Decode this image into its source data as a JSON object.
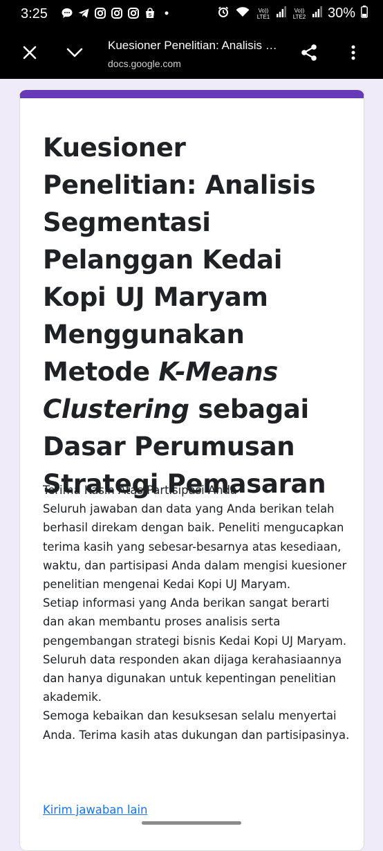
{
  "status_bar": {
    "time": "3:25",
    "battery": "30%",
    "lte1": "Vo)) LTE1",
    "lte2": "Vo)) LTE2",
    "icons": [
      "message-icon",
      "telegram-icon",
      "instagram-icon",
      "instagram-icon",
      "instagram-icon",
      "shopee-icon",
      "dot-icon",
      "alarm-icon",
      "wifi-icon",
      "signal-icon",
      "battery-icon"
    ]
  },
  "app_bar": {
    "title": "Kuesioner Penelitian: Analisis Segmentasi Pelanggan Kedai Kopi UJ Maryam Menggunakan Metode K-Means Clustering sebagai Dasar Perumusan Strategi Pemasaran",
    "url": "docs.google.com"
  },
  "form": {
    "title_part1": "Kuesioner Penelitian:  Analisis Segmentasi Pelanggan Kedai Kopi UJ Maryam Menggunakan Metode ",
    "title_italic": "K-Means Clustering",
    "title_part2": " sebagai Dasar Perumusan Strategi Pemasaran",
    "accent_color": "#673ab7",
    "confirmation": [
      "Terima Kasih Atas Partisipasi Anda",
      "Seluruh jawaban dan data yang Anda berikan telah berhasil direkam dengan baik. Peneliti mengucapkan terima kasih yang sebesar-besarnya atas kesediaan, waktu, dan partisipasi Anda dalam mengisi kuesioner penelitian mengenai Kedai Kopi UJ Maryam.",
      "Setiap informasi yang Anda berikan sangat berarti dan akan membantu proses analisis serta pengembangan strategi bisnis Kedai Kopi UJ Maryam. Seluruh data responden akan dijaga kerahasiaannya dan hanya digunakan untuk kepentingan penelitian akademik.",
      "Semoga kebaikan dan kesuksesan selalu menyertai Anda. Terima kasih atas dukungan dan partisipasinya."
    ],
    "submit_another_label": "Kirim jawaban lain"
  }
}
